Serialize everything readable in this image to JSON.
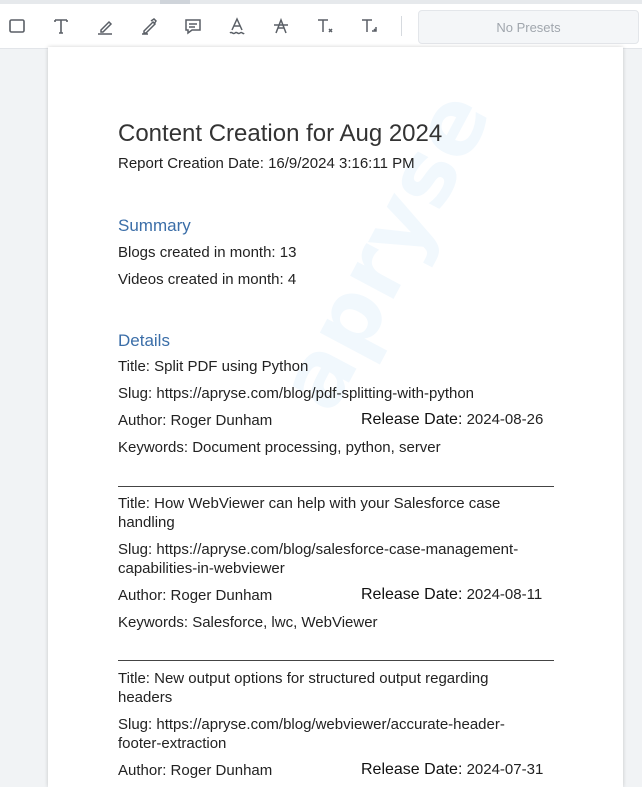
{
  "toolbar": {
    "tools": [
      {
        "icon": "rectangle-icon",
        "name": "rectangle-tool-button"
      },
      {
        "icon": "text-icon",
        "name": "free-text-tool-button"
      },
      {
        "icon": "signature-pen-icon",
        "name": "freehand-tool-button"
      },
      {
        "icon": "pen-icon",
        "name": "pen-tool-button"
      },
      {
        "icon": "comment-icon",
        "name": "comment-tool-button"
      },
      {
        "icon": "text-underline-squiggly-icon",
        "name": "squiggly-tool-button"
      },
      {
        "icon": "text-strikeout-icon",
        "name": "strikeout-tool-button"
      },
      {
        "icon": "text-subscript-icon",
        "name": "text-insert-tool-button"
      },
      {
        "icon": "text-replace-icon",
        "name": "text-replace-tool-button"
      }
    ],
    "presets_label": "No Presets"
  },
  "document": {
    "title": "Content Creation for Aug 2024",
    "creation_date": "Report Creation Date: 16/9/2024 3:16:11 PM",
    "summary": {
      "heading": "Summary",
      "blogs": "Blogs created in month: 13",
      "videos": "Videos created in month: 4"
    },
    "details": {
      "heading": "Details",
      "entries": [
        {
          "title": "Title: Split PDF using Python",
          "slug": "Slug: https://apryse.com/blog/pdf-splitting-with-python",
          "author": "Author: Roger Dunham",
          "release_label": "Release Date:",
          "release_value": "2024-08-26",
          "keywords": "Keywords: Document processing, python, server"
        },
        {
          "title": "Title: How WebViewer can help with your Salesforce case handling",
          "slug": "Slug: https://apryse.com/blog/salesforce-case-management-capabilities-in-webviewer",
          "author": "Author: Roger Dunham",
          "release_label": "Release Date:",
          "release_value": "2024-08-11",
          "keywords": "Keywords: Salesforce, lwc, WebViewer"
        },
        {
          "title": "Title: New output options for structured output regarding headers",
          "slug": "Slug: https://apryse.com/blog/webviewer/accurate-header-footer-extraction",
          "author": "Author: Roger Dunham",
          "release_label": "Release Date:",
          "release_value": "2024-07-31"
        }
      ]
    },
    "watermark_text": "apryse"
  },
  "colors": {
    "section_heading": "#3b6ea8",
    "toolbar_icon": "#5a5f66",
    "page_background": "#f1f3f5"
  }
}
